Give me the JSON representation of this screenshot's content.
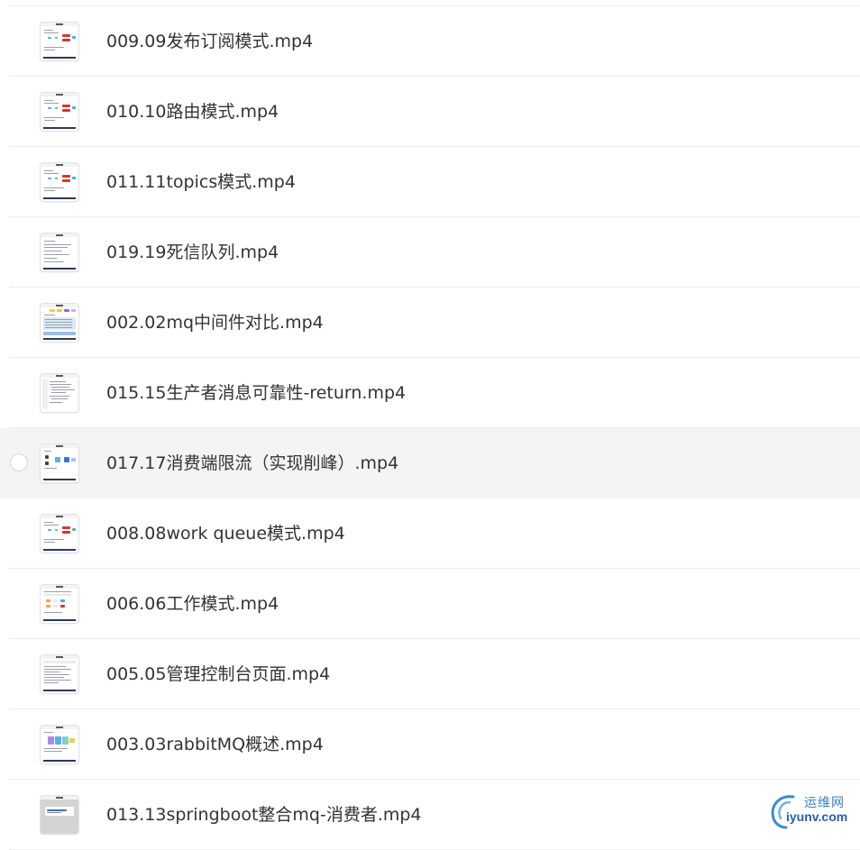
{
  "files": [
    {
      "name": "009.09发布订阅模式.mp4",
      "selected": false,
      "thumb_style": "diagram-red"
    },
    {
      "name": "010.10路由模式.mp4",
      "selected": false,
      "thumb_style": "diagram-red"
    },
    {
      "name": "011.11topics模式.mp4",
      "selected": false,
      "thumb_style": "diagram-red"
    },
    {
      "name": "019.19死信队列.mp4",
      "selected": false,
      "thumb_style": "text-doc"
    },
    {
      "name": "002.02mq中间件对比.mp4",
      "selected": false,
      "thumb_style": "table-color"
    },
    {
      "name": "015.15生产者消息可靠性-return.mp4",
      "selected": false,
      "thumb_style": "code"
    },
    {
      "name": "017.17消费端限流（实现削峰）.mp4",
      "selected": true,
      "thumb_style": "diagram-blue"
    },
    {
      "name": "008.08work queue模式.mp4",
      "selected": false,
      "thumb_style": "diagram-red"
    },
    {
      "name": "006.06工作模式.mp4",
      "selected": false,
      "thumb_style": "diagram-orange"
    },
    {
      "name": "005.05管理控制台页面.mp4",
      "selected": false,
      "thumb_style": "console"
    },
    {
      "name": "003.03rabbitMQ概述.mp4",
      "selected": false,
      "thumb_style": "diagram-purple"
    },
    {
      "name": "013.13springboot整合mq-消费者.mp4",
      "selected": false,
      "thumb_style": "gray"
    }
  ],
  "watermark": {
    "chinese_text": "运维网",
    "url_text": "iyunv.com",
    "color": "#2a5fa8"
  },
  "colors": {
    "selected_row_bg": "#f4f4f4",
    "divider": "#ececec",
    "filename_text": "#333333"
  }
}
